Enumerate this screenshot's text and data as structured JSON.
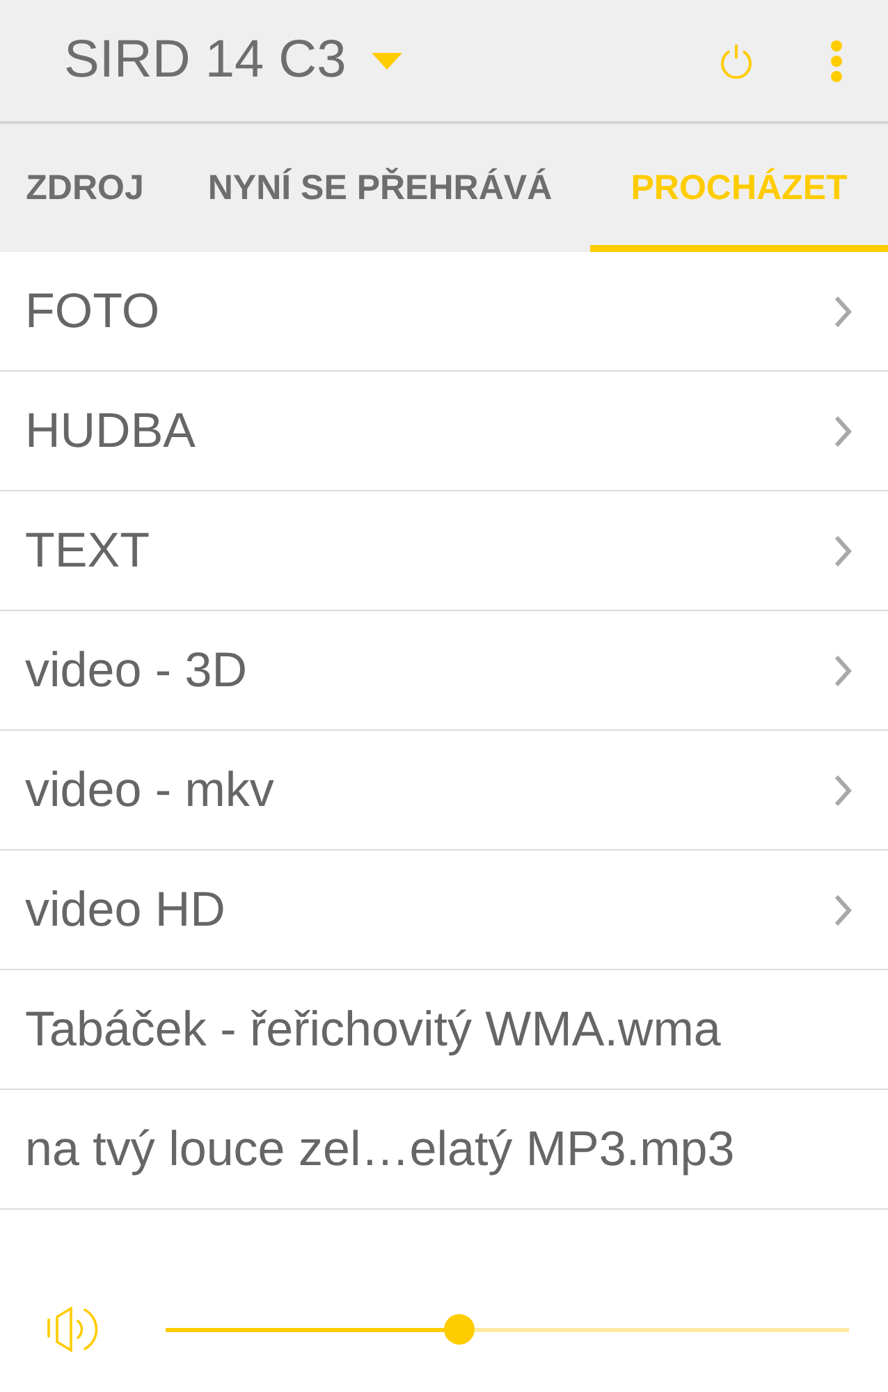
{
  "header": {
    "title": "SIRD 14 C3"
  },
  "tabs": [
    {
      "label": "ZDROJ",
      "selected": false
    },
    {
      "label": "NYNÍ SE PŘEHRÁVÁ",
      "selected": false
    },
    {
      "label": "PROCHÁZET",
      "selected": true
    }
  ],
  "items": [
    {
      "kind": "folder",
      "label": "FOTO"
    },
    {
      "kind": "folder",
      "label": "HUDBA"
    },
    {
      "kind": "folder",
      "label": "TEXT"
    },
    {
      "kind": "folder",
      "label": "video - 3D"
    },
    {
      "kind": "folder",
      "label": "video - mkv"
    },
    {
      "kind": "folder",
      "label": "video HD"
    },
    {
      "kind": "file",
      "label": "Tabáček - řeřichovitý WMA.wma"
    },
    {
      "kind": "file",
      "label": "na tvý louce zel…elatý MP3.mp3"
    }
  ],
  "volume": {
    "level": 0.43
  }
}
